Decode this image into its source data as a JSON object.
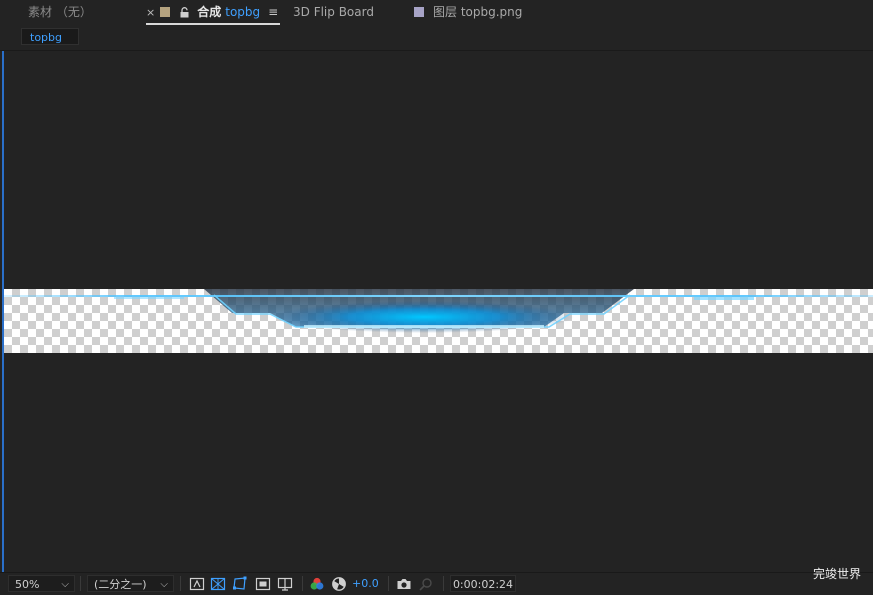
{
  "tabs": {
    "footage": {
      "label": "素材 （无）"
    },
    "composition": {
      "close": "×",
      "color": "#b5a37f",
      "label": "合成",
      "name": "topbg",
      "menu": "≡"
    },
    "flip_board": {
      "label": "3D Flip Board"
    },
    "layer": {
      "color": "#a7a3c6",
      "label": "图层 topbg.png"
    }
  },
  "comp_chip": {
    "label": "topbg"
  },
  "statusbar": {
    "zoom": "50%",
    "resolution": "(二分之一)",
    "exposure": "+0.0",
    "timecode": "0:00:02:24",
    "icons": [
      "always-preview-icon",
      "transparency-grid-icon",
      "mask-path-icon",
      "region-of-interest-icon",
      "guides-icon",
      "color-channels-icon",
      "exposure-reset-icon",
      "snapshot-icon",
      "show-snapshot-icon"
    ]
  },
  "watermark": "完竣世界",
  "colors": {
    "accent": "#3fa0ff",
    "glow": "#00b4ff",
    "background": "#232323"
  }
}
